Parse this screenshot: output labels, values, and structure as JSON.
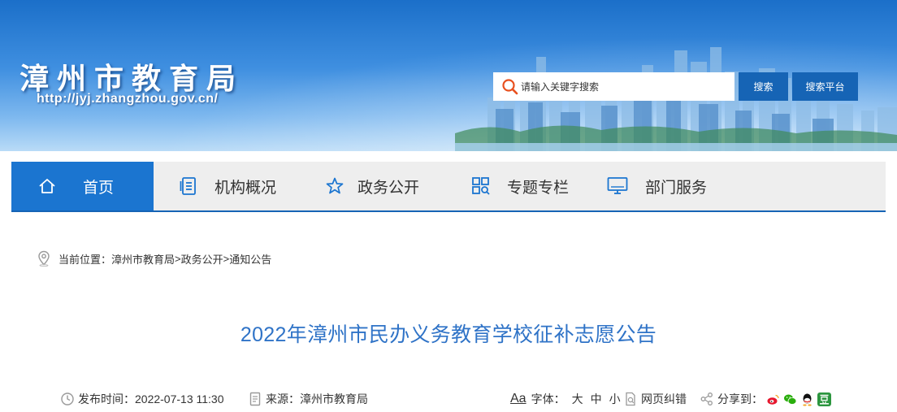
{
  "header": {
    "site_title": "漳州市教育局",
    "site_url": "http://jyj.zhangzhou.gov.cn/",
    "search_placeholder": "请输入关键字搜索",
    "search_button": "搜索",
    "platform_button": "搜索平台"
  },
  "nav": {
    "items": [
      {
        "label": "首页",
        "icon": "home-icon",
        "active": true
      },
      {
        "label": "机构概况",
        "icon": "document-list-icon",
        "active": false
      },
      {
        "label": "政务公开",
        "icon": "star-icon",
        "active": false
      },
      {
        "label": "专题专栏",
        "icon": "grid-search-icon",
        "active": false
      },
      {
        "label": "部门服务",
        "icon": "monitor-icon",
        "active": false
      }
    ]
  },
  "breadcrumb": {
    "prefix": "当前位置：",
    "items": [
      "漳州市教育局",
      "政务公开",
      "通知公告"
    ],
    "separator": ">"
  },
  "article": {
    "title": "2022年漳州市民办义务教育学校征补志愿公告",
    "publish_label": "发布时间：",
    "publish_time": "2022-07-13 11:30",
    "source_label": "来源：",
    "source": "漳州市教育局",
    "font_icon_text": "Aa",
    "font_label": "字体：",
    "font_sizes": [
      "大",
      "中",
      "小"
    ],
    "correction": "网页纠错",
    "share_label": "分享到："
  },
  "colors": {
    "brand_blue": "#1664b5",
    "nav_active": "#1b75d0",
    "title_blue": "#2f73c7"
  },
  "share_icons": [
    "weibo-icon",
    "wechat-icon",
    "qq-icon",
    "douban-icon"
  ]
}
